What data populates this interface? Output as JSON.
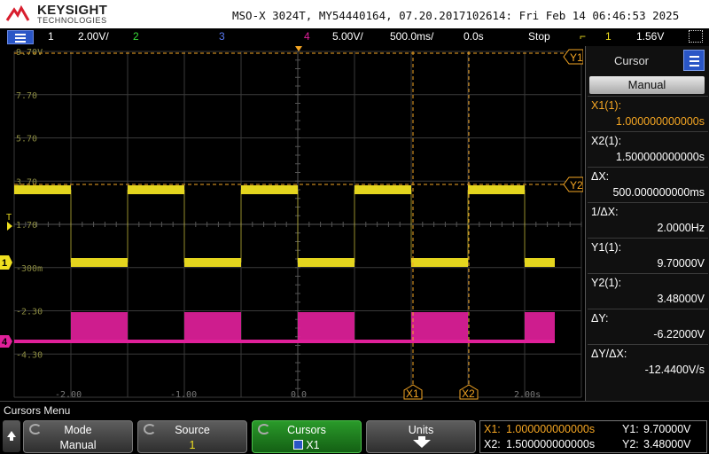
{
  "title_bar": {
    "brand": "KEYSIGHT",
    "brand_sub": "TECHNOLOGIES",
    "instrument_info": "MSO-X 3024T, MY54440164, 07.20.2017102614: Fri Feb 14 06:46:53 2025"
  },
  "status_bar": {
    "ch1_num": "1",
    "ch1_scale": "2.00V/",
    "ch2_num": "2",
    "ch3_num": "3",
    "ch4_num": "4",
    "ch4_scale": "5.00V/",
    "timebase": "500.0ms/",
    "delay": "0.0s",
    "run_state": "Stop",
    "trigger_source": "1",
    "trigger_level": "1.56V",
    "colors": {
      "ch1": "#f0e020",
      "ch2": "#3adf3a",
      "ch3": "#3a6af0",
      "ch4": "#e0209a",
      "stop": "#ff3030",
      "cursor": "#f5a623"
    }
  },
  "grid": {
    "ch1_level_labels": [
      "9.70V",
      "7.70",
      "5.70",
      "3.70",
      "1.70",
      "-300m",
      "-2.30",
      "-4.30"
    ],
    "time_labels": [
      "-2.00",
      "-1.00",
      "0.0",
      "2.00s"
    ],
    "cursor_tags": {
      "y1": "Y1",
      "y2": "Y2",
      "x1": "X1",
      "x2": "X2"
    },
    "ch1_marker": "1",
    "ch4_marker": "4",
    "trigger_marker": "T"
  },
  "right_panel": {
    "title": "Cursor",
    "mode_button": "Manual",
    "readings": [
      {
        "label": "X1(1):",
        "value": "1.000000000000s",
        "highlight": true
      },
      {
        "label": "X2(1):",
        "value": "1.500000000000s",
        "highlight": false
      },
      {
        "label": "ΔX:",
        "value": "500.000000000ms",
        "highlight": false
      },
      {
        "label": "1/ΔX:",
        "value": "2.0000Hz",
        "highlight": false
      },
      {
        "label": "Y1(1):",
        "value": "9.70000V",
        "highlight": false
      },
      {
        "label": "Y2(1):",
        "value": "3.48000V",
        "highlight": false
      },
      {
        "label": "ΔY:",
        "value": "-6.22000V",
        "highlight": false
      },
      {
        "label": "ΔY/ΔX:",
        "value": "-12.4400V/s",
        "highlight": false
      }
    ]
  },
  "menu": {
    "title": "Cursors Menu",
    "softkeys": [
      {
        "label": "Mode",
        "value": "Manual"
      },
      {
        "label": "Source",
        "value": "1"
      },
      {
        "label": "Cursors",
        "value": "X1"
      },
      {
        "label": "Units",
        "value": ""
      }
    ],
    "readout": {
      "x1_label": "X1:",
      "x1_value": "1.000000000000s",
      "x2_label": "X2:",
      "x2_value": "1.500000000000s",
      "y1_label": "Y1:",
      "y1_value": "9.70000V",
      "y2_label": "Y2:",
      "y2_value": "3.48000V"
    }
  }
}
